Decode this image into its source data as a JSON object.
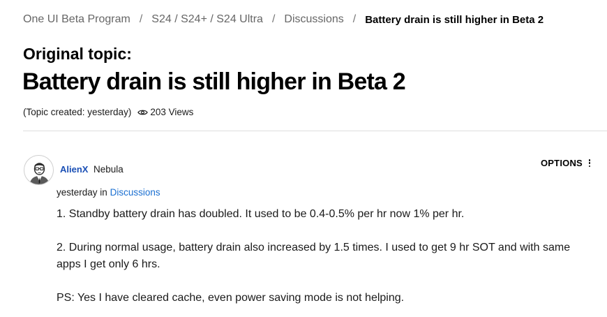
{
  "breadcrumb": {
    "items": [
      "One UI Beta Program",
      "S24 / S24+ / S24 Ultra",
      "Discussions"
    ],
    "separator": "/",
    "current": "Battery drain is still higher in Beta 2"
  },
  "topic": {
    "original_label": "Original topic:",
    "title": "Battery drain is still higher in Beta 2",
    "created": "(Topic created: yesterday)",
    "views": "203 Views",
    "views_icon": "eye-icon"
  },
  "post": {
    "author": "AlienX",
    "rank": "Nebula",
    "avatar_icon": "user-avatar-icon",
    "time": "yesterday",
    "in_text": "in",
    "board": "Discussions",
    "options_label": "OPTIONS",
    "options_icon": "kebab-menu-icon",
    "paragraphs": [
      "1. Standby battery drain has doubled. It used to be 0.4-0.5% per hr now 1% per hr.",
      "2. During normal usage, battery drain also increased by 1.5 times. I used to get 9 hr SOT and with same apps I get only 6 hrs.",
      "PS: Yes I have cleared cache, even power saving mode is not helping."
    ]
  },
  "colors": {
    "author_link": "#1a4fb5",
    "board_link": "#1a6fd1",
    "divider": "#dedede",
    "breadcrumb_link": "#666666"
  }
}
